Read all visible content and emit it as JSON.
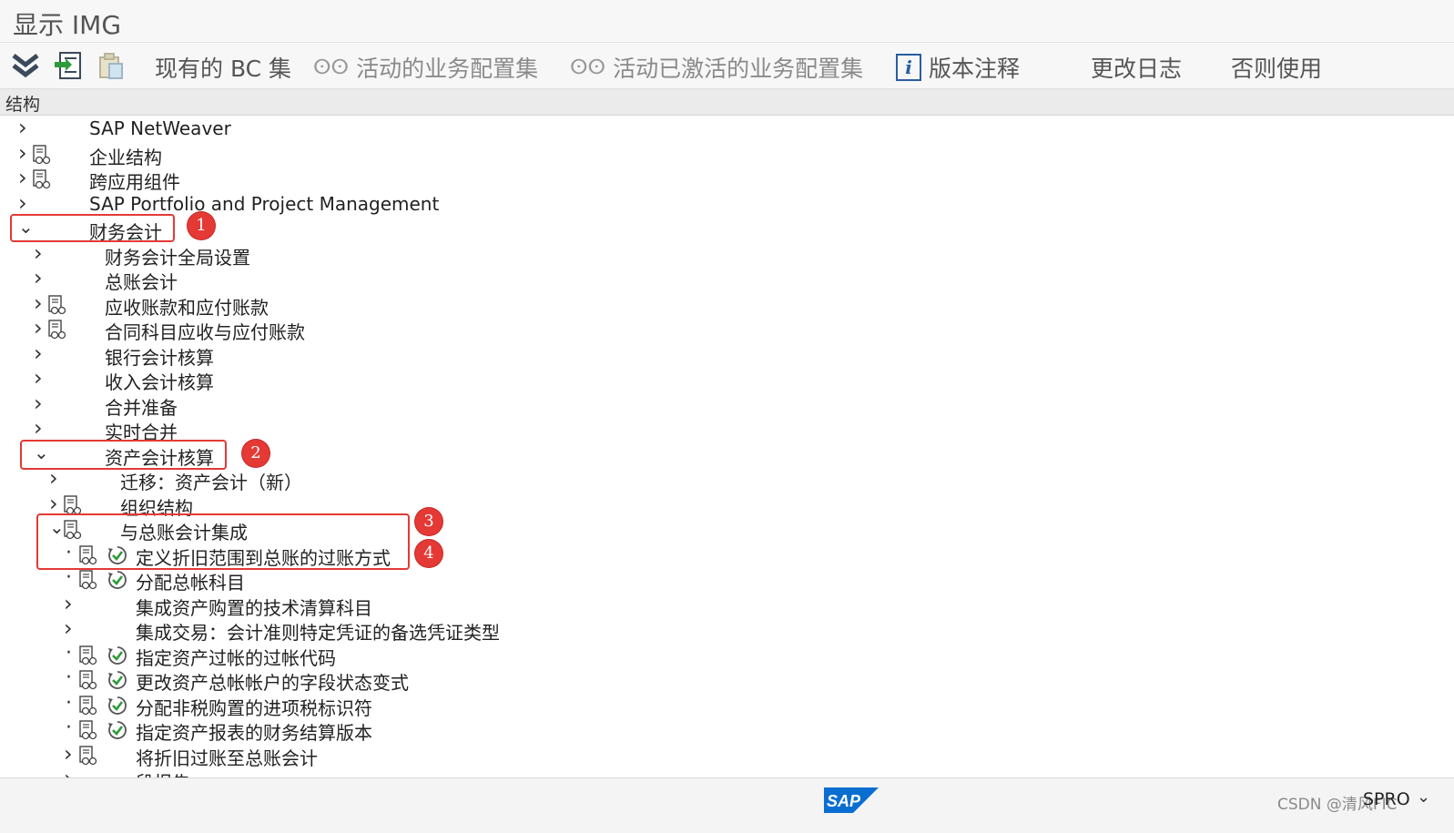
{
  "window": {
    "title": "显示 IMG"
  },
  "toolbar": {
    "existing_bc": "现有的 BC 集",
    "active_bc": "活动的业务配置集",
    "activated_bc": "活动已激活的业务配置集",
    "release_notes": "版本注释",
    "change_log": "更改日志",
    "else_use": "否则使用"
  },
  "structure": {
    "header": "结构"
  },
  "tree": [
    {
      "label": "SAP NetWeaver"
    },
    {
      "label": "企业结构"
    },
    {
      "label": "跨应用组件"
    },
    {
      "label": "SAP Portfolio and Project Management"
    },
    {
      "label": "财务会计"
    },
    {
      "label": "财务会计全局设置"
    },
    {
      "label": "总账会计"
    },
    {
      "label": "应收账款和应付账款"
    },
    {
      "label": "合同科目应收与应付账款"
    },
    {
      "label": "银行会计核算"
    },
    {
      "label": "收入会计核算"
    },
    {
      "label": "合并准备"
    },
    {
      "label": "实时合并"
    },
    {
      "label": "资产会计核算"
    },
    {
      "label": "迁移：资产会计（新）"
    },
    {
      "label": "组织结构"
    },
    {
      "label": "与总账会计集成"
    },
    {
      "label": "定义折旧范围到总账的过账方式"
    },
    {
      "label": "分配总帐科目"
    },
    {
      "label": "集成资产购置的技术清算科目"
    },
    {
      "label": "集成交易：会计准则特定凭证的备选凭证类型"
    },
    {
      "label": "指定资产过帐的过帐代码"
    },
    {
      "label": "更改资产总帐帐户的字段状态变式"
    },
    {
      "label": "分配非税购置的进项税标识符"
    },
    {
      "label": "指定资产报表的财务结算版本"
    },
    {
      "label": "将折旧过账至总账会计"
    },
    {
      "label": "段报告"
    }
  ],
  "markers": [
    "1",
    "2",
    "3",
    "4"
  ],
  "footer": {
    "logo": "SAP",
    "watermark": "CSDN @清风FIC",
    "tcode": "SPRO"
  }
}
